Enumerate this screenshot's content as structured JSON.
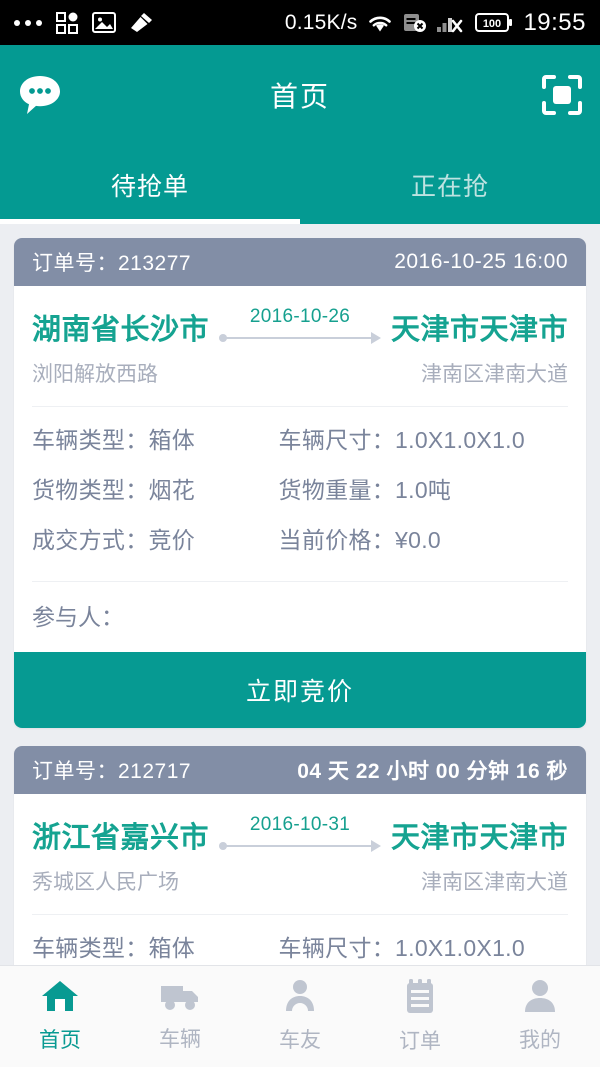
{
  "statusbar": {
    "icons_left": [
      "more-dots-icon",
      "app-grid-icon",
      "image-icon",
      "brush-icon"
    ],
    "network_speed": "0.15K/s",
    "icons_right": [
      "wifi-icon",
      "sim-disabled-icon",
      "signal-off-icon"
    ],
    "battery": "100",
    "time": "19:55"
  },
  "header": {
    "left_icon": "chat-bubble-icon",
    "title": "首页",
    "right_icon": "scan-icon"
  },
  "tabs": [
    {
      "label": "待抢单",
      "active": true
    },
    {
      "label": "正在抢",
      "active": false
    }
  ],
  "orders": [
    {
      "order_label": "订单号：213277",
      "meta": "2016-10-25   16:00",
      "meta_bold": false,
      "from_city": "湖南省长沙市",
      "to_city": "天津市天津市",
      "date": "2016-10-26",
      "from_addr": "浏阳解放西路",
      "to_addr": "津南区津南大道",
      "details": [
        {
          "left": "车辆类型：箱体",
          "right": "车辆尺寸：1.0X1.0X1.0"
        },
        {
          "left": "货物类型：烟花",
          "right": "货物重量：1.0吨"
        },
        {
          "left": "成交方式：竞价",
          "right": "当前价格：¥0.0"
        }
      ],
      "participants_label": "参与人：",
      "participants_value": "",
      "action_label": "立即竞价"
    },
    {
      "order_label": "订单号：212717",
      "meta": "04 天 22 小时 00 分钟 16 秒",
      "meta_bold": true,
      "from_city": "浙江省嘉兴市",
      "to_city": "天津市天津市",
      "date": "2016-10-31",
      "from_addr": "秀城区人民广场",
      "to_addr": "津南区津南大道",
      "details": [
        {
          "left": "车辆类型：箱体",
          "right": "车辆尺寸：1.0X1.0X1.0"
        }
      ]
    }
  ],
  "bottomnav": [
    {
      "label": "首页",
      "icon": "home-icon",
      "active": true
    },
    {
      "label": "车辆",
      "icon": "truck-icon",
      "active": false
    },
    {
      "label": "车友",
      "icon": "person-icon",
      "active": false
    },
    {
      "label": "订单",
      "icon": "clipboard-icon",
      "active": false
    },
    {
      "label": "我的",
      "icon": "user-icon",
      "active": false
    }
  ],
  "colors": {
    "brand_teal": "#049A92",
    "card_head_gray": "#828EA6",
    "page_bg": "#ECEEF2",
    "city_teal": "#15A391",
    "detail_text": "#7A849B"
  }
}
